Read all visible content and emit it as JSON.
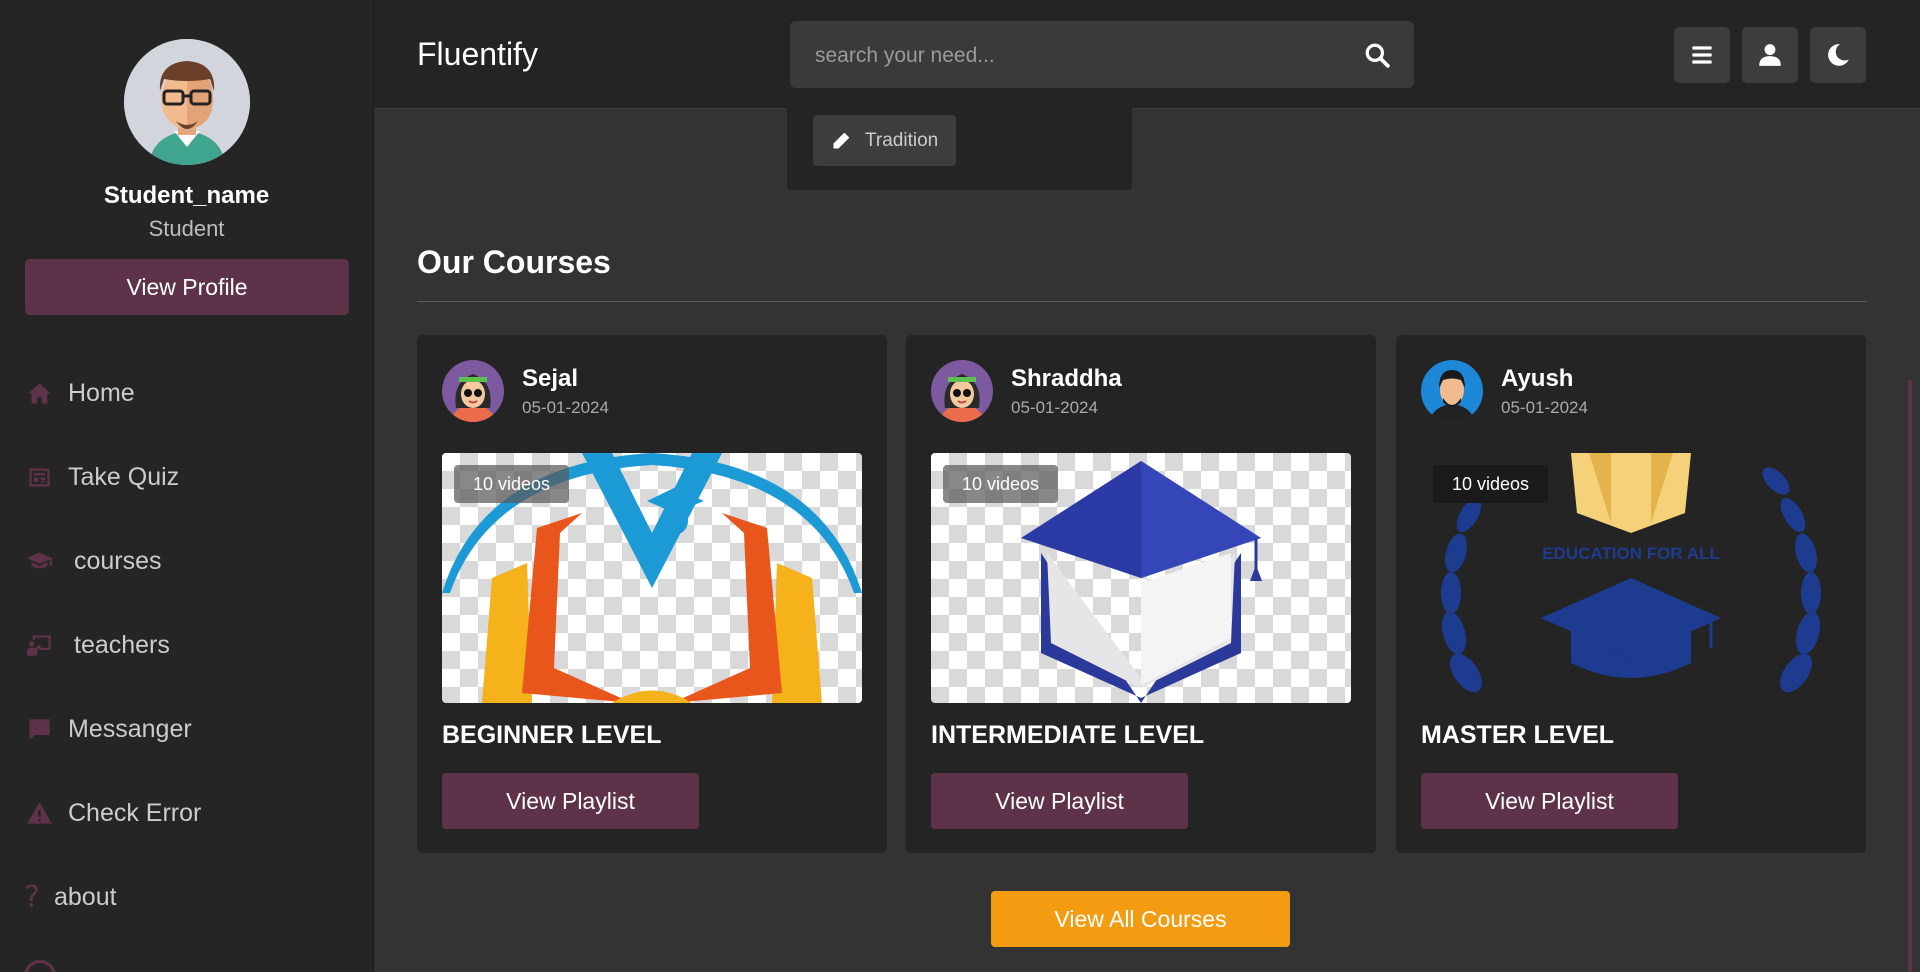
{
  "sidebar": {
    "profile": {
      "name": "Student_name",
      "role": "Student",
      "button_label": "View Profile"
    },
    "items": [
      {
        "label": "Home",
        "icon": "home-icon"
      },
      {
        "label": "Take Quiz",
        "icon": "quiz-icon"
      },
      {
        "label": "courses",
        "icon": "graduation-cap-icon"
      },
      {
        "label": "teachers",
        "icon": "teacher-icon"
      },
      {
        "label": "Messanger",
        "icon": "message-icon"
      },
      {
        "label": "Check Error",
        "icon": "warning-icon"
      },
      {
        "label": "about",
        "icon": "question-icon"
      }
    ]
  },
  "header": {
    "logo": "Fluentify",
    "search": {
      "placeholder": "search your need..."
    },
    "buttons": [
      "menu-icon",
      "user-icon",
      "moon-icon"
    ]
  },
  "tradition": {
    "label": "Tradition"
  },
  "courses_section": {
    "title": "Our Courses",
    "cards": [
      {
        "author": "Sejal",
        "date": "05-01-2024",
        "videos": "10 videos",
        "title": "BEGINNER LEVEL",
        "button": "View Playlist"
      },
      {
        "author": "Shraddha",
        "date": "05-01-2024",
        "videos": "10 videos",
        "title": "INTERMEDIATE LEVEL",
        "button": "View Playlist"
      },
      {
        "author": "Ayush",
        "date": "05-01-2024",
        "videos": "10 videos",
        "title": "MASTER LEVEL",
        "button": "View Playlist",
        "thumb_text": "EDUCATION FOR ALL"
      }
    ],
    "view_all_label": "View All Courses"
  },
  "colors": {
    "accent": "#5e3349",
    "orange": "#f39c12",
    "sidebar_bg": "#252525",
    "content_bg": "#333333"
  }
}
